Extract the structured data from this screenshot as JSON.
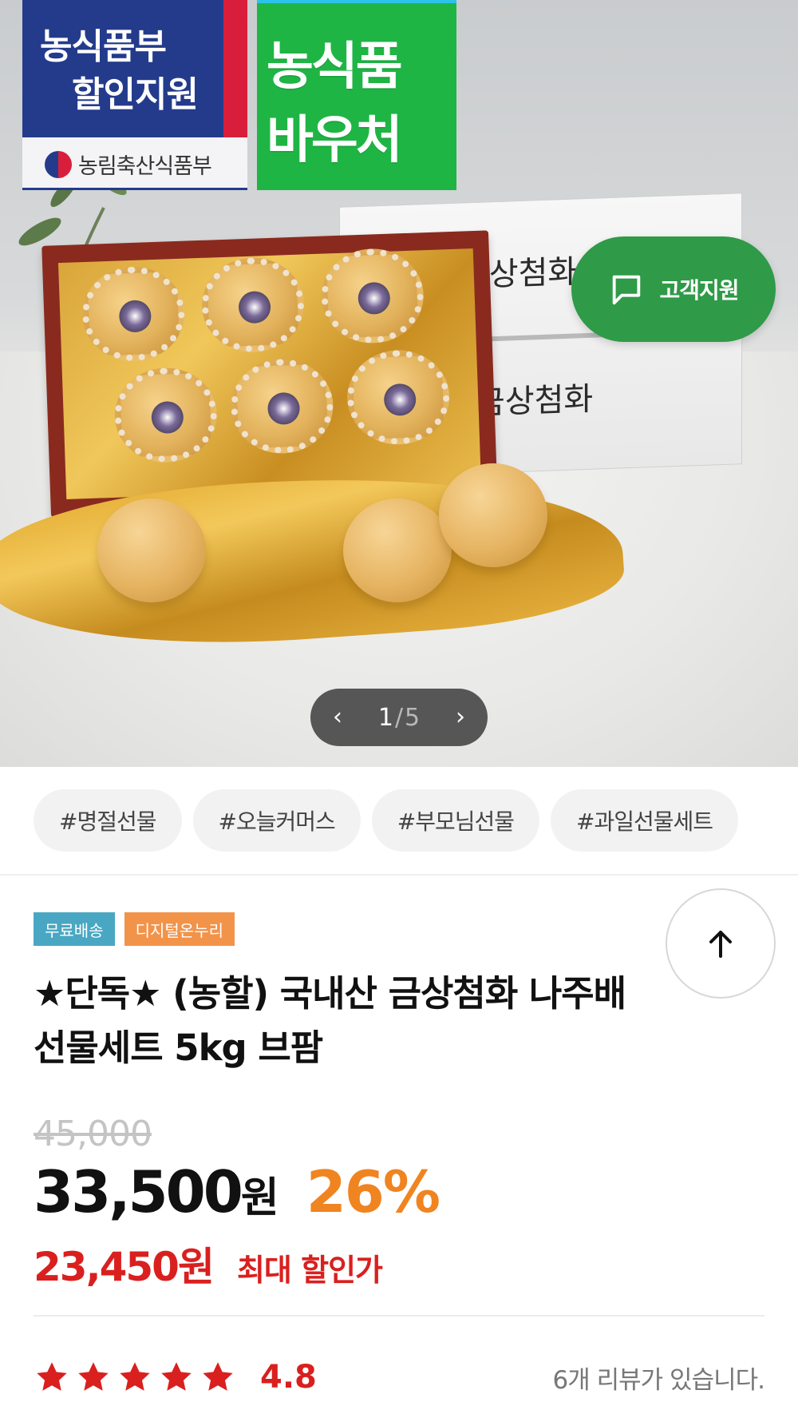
{
  "hero": {
    "badge_left": {
      "line1": "농식품부",
      "line2": "할인지원",
      "ministry": "농림축산식품부"
    },
    "badge_right": {
      "line1": "농식품",
      "line2": "바우처"
    },
    "box_brand": "금상첨화",
    "support_button": {
      "label": "고객지원",
      "icon": "chat-bubble-icon"
    },
    "pager": {
      "current": "1",
      "separator": "/",
      "total": "5"
    }
  },
  "tags": [
    "#명절선물",
    "#오늘커머스",
    "#부모님선물",
    "#과일선물세트"
  ],
  "product": {
    "labels": [
      "무료배송",
      "디지털온누리"
    ],
    "title_line1": "★단독★ (농할) 국내산 금상첨화 나주배",
    "title_line2": "선물세트 5kg 브팜",
    "original_price": "45,000",
    "price": "33,500",
    "currency": "원",
    "discount": "26%",
    "max_discount_price": "23,450원",
    "max_discount_label": "최대 할인가",
    "rating": "4.8",
    "stars": 5,
    "review_text": "6개 리뷰가 있습니다."
  },
  "colors": {
    "accent_green": "#2f9a47",
    "price_red": "#d9201f",
    "discount_orange": "#f08420",
    "label_blue": "#49a7c3",
    "label_orange": "#f2934a"
  }
}
